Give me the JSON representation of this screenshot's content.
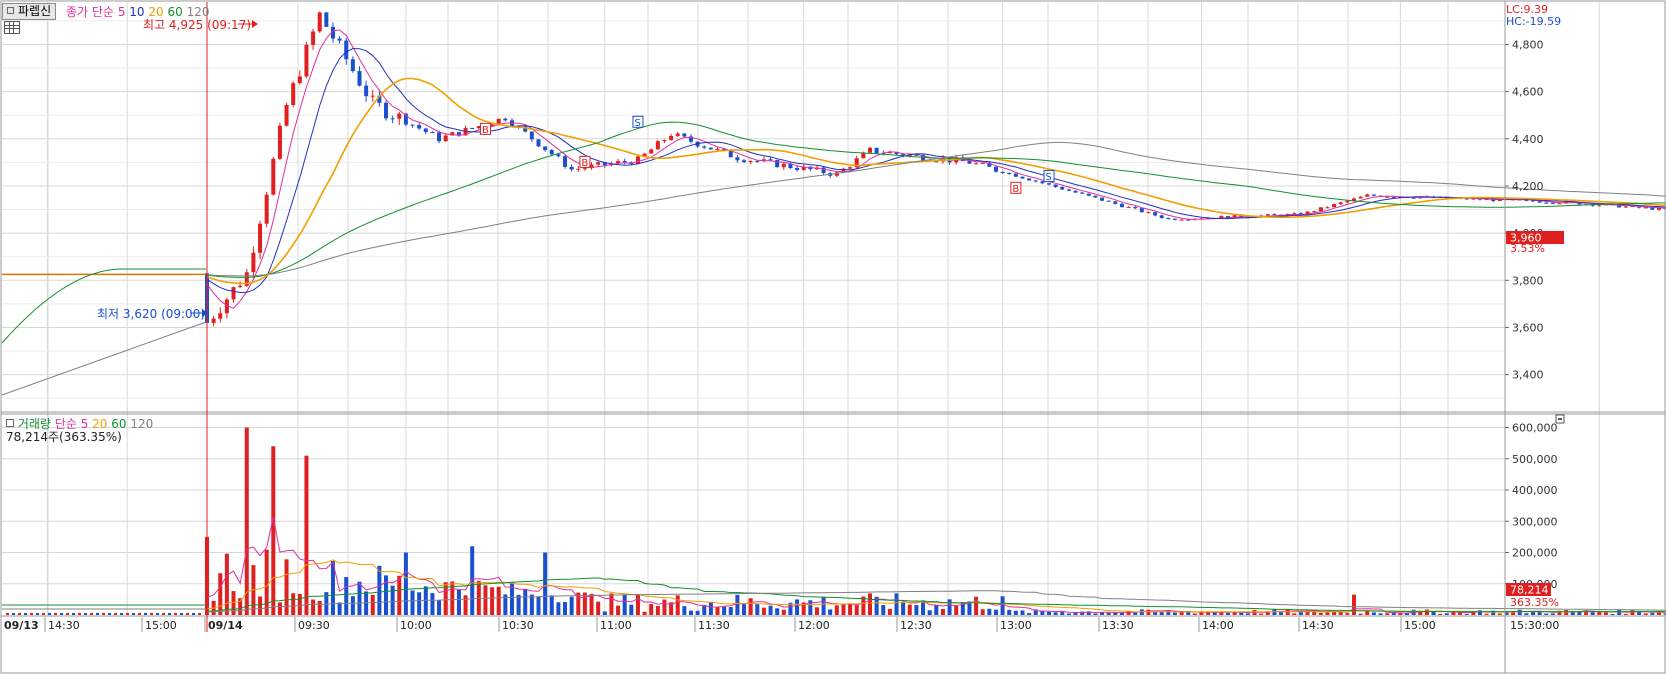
{
  "price_panel": {
    "tab_label": "파렙신",
    "legend_title": "종가 단순",
    "ma_periods": [
      "5",
      "10",
      "20",
      "60",
      "120"
    ],
    "ma_colors": [
      "#e0309e",
      "#2030c0",
      "#f0a000",
      "#109030",
      "#808080"
    ],
    "lc_label": "LC:9.39",
    "hc_label": "HC:-19.59",
    "high_note": "최고 4,925 (09:17)",
    "low_note": "최저 3,620 (09:00)",
    "current_price": "3,960",
    "current_change": "3.53%",
    "y_ticks": [
      "4,800",
      "4,600",
      "4,400",
      "4,200",
      "4,000",
      "3,800",
      "3,600",
      "3,400"
    ]
  },
  "volume_panel": {
    "legend_title": "거래량",
    "legend_sub": "단순",
    "ma_periods": [
      "5",
      "20",
      "60",
      "120"
    ],
    "volume_label": "78,214주(363.35%)",
    "current_volume": "78,214",
    "current_volume_pct": "363.35%",
    "y_ticks": [
      "600,000",
      "500,000",
      "400,000",
      "300,000",
      "200,000",
      "100,000"
    ]
  },
  "x_axis": {
    "labels": [
      "09/13",
      "14:30",
      "15:00",
      "09/14",
      "09:30",
      "10:00",
      "10:30",
      "11:00",
      "11:30",
      "12:00",
      "12:30",
      "13:00",
      "13:30",
      "14:00",
      "14:30",
      "15:00",
      "15:30:00"
    ]
  },
  "markers": [
    "B",
    "B",
    "S",
    "B",
    "S"
  ],
  "colors": {
    "up": "#e02020",
    "down": "#1a4fd0",
    "grid": "#d8d8d8",
    "price_box": "#e02020"
  },
  "chart_data": {
    "type": "candlestick",
    "price_ylim": [
      3250,
      4980
    ],
    "volume_ylim": [
      0,
      640000
    ],
    "anchors": [
      {
        "t": "09/13 14:20",
        "price": 3825
      },
      {
        "t": "09/14 09:00",
        "price": 3620
      },
      {
        "t": "09/14 09:06",
        "price": 3830
      },
      {
        "t": "09/14 09:12",
        "price": 4540
      },
      {
        "t": "09/14 09:17",
        "price": 4925
      },
      {
        "t": "09/14 09:25",
        "price": 4550
      },
      {
        "t": "09/14 09:35",
        "price": 4400
      },
      {
        "t": "09/14 09:45",
        "price": 4490
      },
      {
        "t": "09/14 09:55",
        "price": 4270
      },
      {
        "t": "09/14 10:05",
        "price": 4310
      },
      {
        "t": "09/14 10:10",
        "price": 4420
      },
      {
        "t": "09/14 10:20",
        "price": 4320
      },
      {
        "t": "09/14 10:35",
        "price": 4250
      },
      {
        "t": "09/14 10:40",
        "price": 4350
      },
      {
        "t": "09/14 10:55",
        "price": 4300
      },
      {
        "t": "09/14 11:10",
        "price": 4180
      },
      {
        "t": "09/14 11:25",
        "price": 4060
      },
      {
        "t": "09/14 11:45",
        "price": 4080
      },
      {
        "t": "09/14 11:55",
        "price": 4160
      },
      {
        "t": "09/14 12:25",
        "price": 4130
      },
      {
        "t": "09/14 12:45",
        "price": 4090
      },
      {
        "t": "09/14 13:15",
        "price": 4100
      },
      {
        "t": "09/14 13:40",
        "price": 4060
      },
      {
        "t": "09/14 14:00",
        "price": 3990
      },
      {
        "t": "09/14 14:30",
        "price": 3990
      },
      {
        "t": "09/14 14:50",
        "price": 4030
      },
      {
        "t": "09/14 15:20",
        "price": 3960
      }
    ],
    "volume_peaks": [
      {
        "t": "09/14 09:00",
        "volume": 250000
      },
      {
        "t": "09/14 09:06",
        "volume": 600000
      },
      {
        "t": "09/14 09:10",
        "volume": 540000
      },
      {
        "t": "09/14 09:15",
        "volume": 510000
      },
      {
        "t": "09/14 09:30",
        "volume": 200000
      },
      {
        "t": "09/14 09:40",
        "volume": 220000
      },
      {
        "t": "09/14 09:51",
        "volume": 200000
      },
      {
        "t": "09/14 15:20",
        "volume": 78214
      }
    ]
  }
}
